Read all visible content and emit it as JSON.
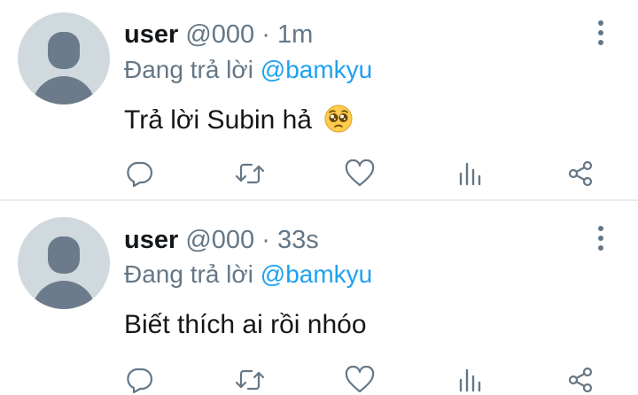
{
  "tweets": [
    {
      "name": "user",
      "handle": "@000",
      "separator": "·",
      "time": "1m",
      "replying_prefix": "Đang trả lời",
      "replying_to": "@bamkyu",
      "text": "Trả lời Subin hả",
      "emoji": "pleading-face-emoji"
    },
    {
      "name": "user",
      "handle": "@000",
      "separator": "·",
      "time": "33s",
      "replying_prefix": "Đang trả lời",
      "replying_to": "@bamkyu",
      "text": "Biết thích ai rồi nhóo"
    }
  ],
  "icons": {
    "more": "more-vertical-icon",
    "reply": "reply-bubble-icon",
    "retweet": "retweet-icon",
    "like": "heart-icon",
    "stats": "bar-chart-icon",
    "share": "share-icon"
  },
  "colors": {
    "accent": "#1da1f2",
    "secondary_text": "#657786",
    "icon": "#657786",
    "avatar_bg": "#cfd9de",
    "avatar_fg": "#6b7b8c",
    "divider": "#e6ecf0"
  }
}
